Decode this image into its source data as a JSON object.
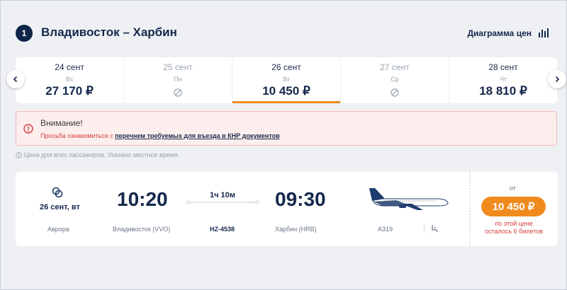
{
  "header": {
    "step": "1",
    "route": "Владивосток – Харбин",
    "chart_link": "Диаграмма цен",
    "chart_icon": "bar-chart-icon"
  },
  "dates": [
    {
      "date": "24 сент",
      "weekday": "Вс",
      "price": "27 170 ₽",
      "available": true,
      "selected": false
    },
    {
      "date": "25 сент",
      "weekday": "Пн",
      "price": "",
      "available": false,
      "selected": false
    },
    {
      "date": "26 сент",
      "weekday": "Вт",
      "price": "10 450 ₽",
      "available": true,
      "selected": true
    },
    {
      "date": "27 сент",
      "weekday": "Ср",
      "price": "",
      "available": false,
      "selected": false
    },
    {
      "date": "28 сент",
      "weekday": "Чт",
      "price": "18 810 ₽",
      "available": true,
      "selected": false
    }
  ],
  "warning": {
    "title": "Внимание!",
    "text_prefix": "Просьба ознакомиться с ",
    "link": "перечнем требуемых для въезда в КНР документов"
  },
  "price_note": "Цена для всех пассажиров. Указано местное время.",
  "flight": {
    "date": "26 сент, вт",
    "airline": "Аврора",
    "dep_time": "10:20",
    "dep_airport": "Владивосток (VVO)",
    "duration": "1ч 10м",
    "flight_number": "HZ-4538",
    "arr_time": "09:30",
    "arr_airport": "Харбин (HRB)",
    "aircraft": "A319",
    "price_from": "от",
    "price": "10 450 ₽",
    "seats_line1": "по этой цене",
    "seats_line2": "осталось 6 билетов"
  },
  "colors": {
    "accent": "#f08a1c",
    "navy": "#14284b",
    "warning_bg": "#fdeeee",
    "warning_red": "#d43d3d"
  }
}
